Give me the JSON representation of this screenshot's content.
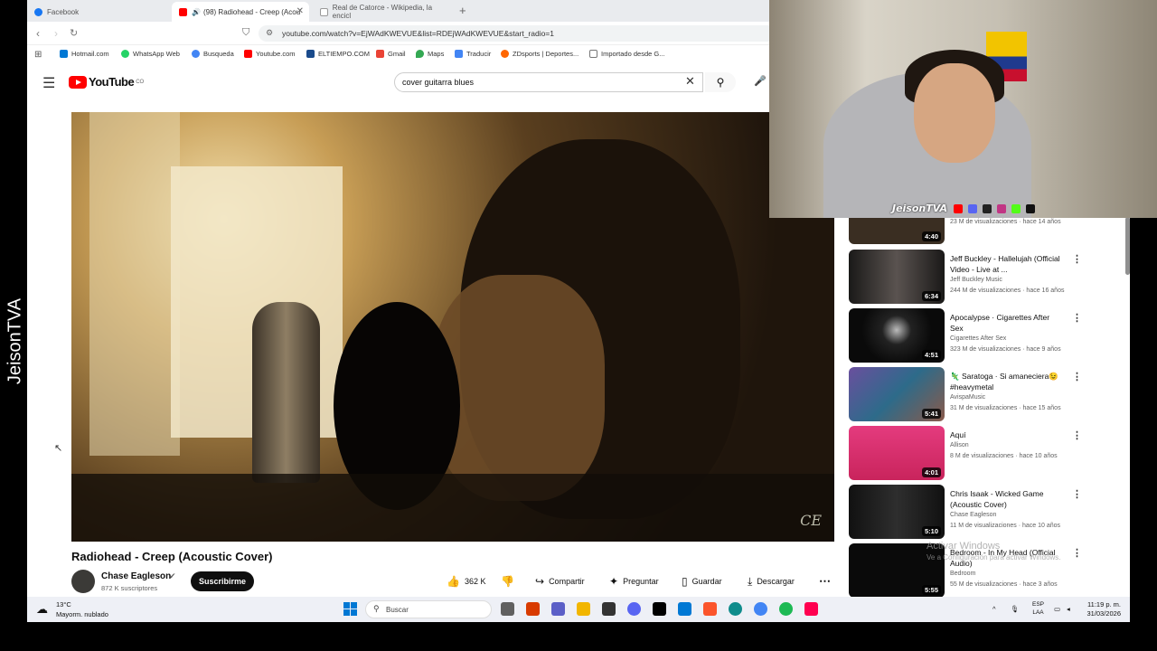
{
  "streamer": {
    "vertical_name": "JeisonTVA",
    "webcam_label": "JeisonTVA"
  },
  "tabs": [
    {
      "label": "Facebook",
      "color": "#1877f2"
    },
    {
      "label": "(98) Radiohead - Creep (Acou",
      "color": "#ff0000"
    },
    {
      "label": "Real de Catorce - Wikipedia, la encicl",
      "color": "#555555"
    }
  ],
  "address": {
    "url": "youtube.com/watch?v=EjWAdKWEVUE&list=RDEjWAdKWEVUE&start_radio=1"
  },
  "bookmarks": [
    {
      "label": "Hotmail.com",
      "color": "#0078d4"
    },
    {
      "label": "WhatsApp Web",
      "color": "#25d366"
    },
    {
      "label": "Busqueda",
      "color": "#4285f4"
    },
    {
      "label": "Youtube.com",
      "color": "#ff0000"
    },
    {
      "label": "ELTIEMPO.COM",
      "color": "#1a4b8c"
    },
    {
      "label": "Gmail",
      "color": "#ea4335"
    },
    {
      "label": "Maps",
      "color": "#34a853"
    },
    {
      "label": "Traducir",
      "color": "#4285f4"
    },
    {
      "label": "ZDsports | Deportes...",
      "color": "#ff6600"
    },
    {
      "label": "Importado desde G...",
      "color": "#999999"
    }
  ],
  "youtube": {
    "logo": "YouTube",
    "country": "CO",
    "search_query": "cover guitarra blues"
  },
  "video": {
    "title": "Radiohead - Creep (Acoustic Cover)",
    "channel": "Chase Eagleson",
    "subscribers": "872 K suscriptores",
    "subscribe_label": "Suscribirme",
    "likes": "362 K",
    "share_label": "Compartir",
    "ask_label": "Preguntar",
    "save_label": "Guardar",
    "download_label": "Descargar",
    "watermark": "CE"
  },
  "recommendations": [
    {
      "title": "",
      "channel": "",
      "meta": "23 M de visualizaciones · hace 14 años",
      "duration": "4:40",
      "thumb": "#3a2e22"
    },
    {
      "title": "Jeff Buckley - Hallelujah (Official Video - Live at ...",
      "channel": "Jeff Buckley Music",
      "meta": "244 M de visualizaciones · hace 16 años",
      "duration": "6:34",
      "thumb": "#2d2b2a"
    },
    {
      "title": "Apocalypse · Cigarettes After Sex",
      "channel": "Cigarettes After Sex",
      "meta": "323 M de visualizaciones · hace 9 años",
      "duration": "4:51",
      "thumb": "#111111"
    },
    {
      "title": "🦎 Saratoga · Si amaneciera😉 #heavymetal",
      "channel": "AvispaMusic",
      "meta": "31 M de visualizaciones · hace 15 años",
      "duration": "5:41",
      "thumb": "#4a3d6a"
    },
    {
      "title": "Aquí",
      "channel": "Allison",
      "meta": "8 M de visualizaciones · hace 10 años",
      "duration": "4:01",
      "thumb": "#d4326e"
    },
    {
      "title": "Chris Isaak - Wicked Game (Acoustic Cover)",
      "channel": "Chase Eagleson",
      "meta": "11 M de visualizaciones · hace 10 años",
      "duration": "5:10",
      "thumb": "#1c1c1c"
    },
    {
      "title": "Bedroom - In My Head (Official Audio)",
      "channel": "Bedroom",
      "meta": "55 M de visualizaciones · hace 3 años",
      "duration": "5:55",
      "thumb": "#0a0a0a"
    }
  ],
  "windows_notice": {
    "title": "Activar Windows",
    "subtitle": "Ve a Configuración para activar Windows."
  },
  "taskbar": {
    "temperature": "13°C",
    "weather": "Mayorm. nublado",
    "search_placeholder": "Buscar",
    "lang_top": "ESP",
    "lang_bottom": "LAA",
    "time": "11:19 p. m.",
    "date": "31/03/2026",
    "app_colors": [
      "#606060",
      "#d83b01",
      "#5b5fc7",
      "#f2b600",
      "#333333",
      "#5865f2",
      "#000000",
      "#0078d4",
      "#fb542b",
      "#0f8c8c",
      "#4285f4",
      "#1db954",
      "#ff0050"
    ]
  }
}
